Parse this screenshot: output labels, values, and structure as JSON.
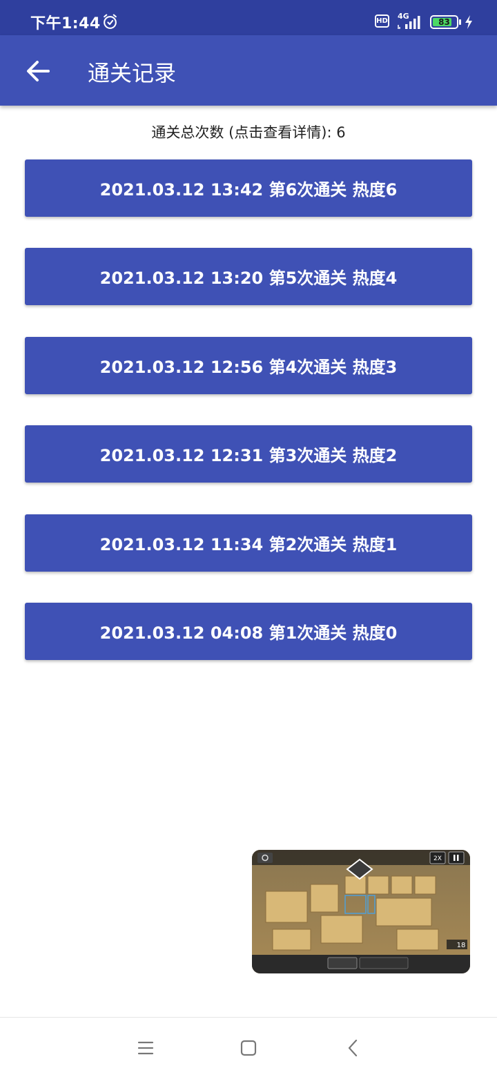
{
  "status_bar": {
    "time": "下午1:44",
    "hd_label": "HD",
    "network_label": "4G",
    "battery_level": 83,
    "battery_text": "83"
  },
  "app_bar": {
    "title": "通关记录",
    "back_icon": "arrow-left-icon"
  },
  "summary": {
    "text": "通关总次数 (点击查看详情): 6"
  },
  "records": [
    {
      "label": "2021.03.12 13:42 第6次通关 热度6"
    },
    {
      "label": "2021.03.12 13:20 第5次通关 热度4"
    },
    {
      "label": "2021.03.12 12:56 第4次通关 热度3"
    },
    {
      "label": "2021.03.12 12:31 第3次通关 热度2"
    },
    {
      "label": "2021.03.12 11:34 第2次通关 热度1"
    },
    {
      "label": "2021.03.12 04:08 第1次通关 热度0"
    }
  ],
  "mini_window": {
    "speed_label": "2X",
    "count_label": "18"
  },
  "nav_bar": {
    "icons": [
      "menu-icon",
      "home-square-icon",
      "back-chevron-icon"
    ]
  },
  "colors": {
    "status_bar": "#2f3f9e",
    "primary": "#3f51b5",
    "text_on_primary": "#ffffff",
    "battery_fill": "#4cd964"
  }
}
